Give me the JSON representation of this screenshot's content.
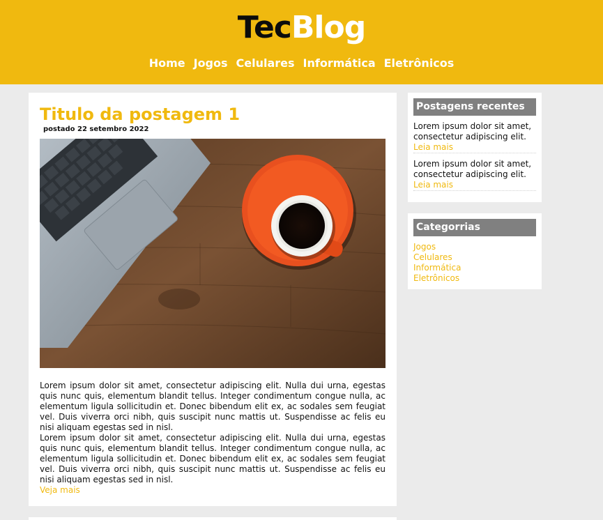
{
  "header": {
    "logo_part1": "Tec",
    "logo_part2": "Blog",
    "nav": [
      "Home",
      "Jogos",
      "Celulares",
      "Informática",
      "Eletrônicos"
    ]
  },
  "post": {
    "title": "Titulo da postagem 1",
    "date": "postado 22 setembro 2022",
    "image": "laptop and orange coffee cup on wooden desk",
    "paragraphs": [
      "Lorem ipsum dolor sit amet, consectetur adipiscing elit. Nulla dui urna, egestas quis nunc quis, elementum blandit tellus. Integer condimentum congue nulla, ac elementum ligula sollicitudin et. Donec bibendum elit ex, ac sodales sem feugiat vel. Duis viverra orci nibh, quis suscipit nunc mattis ut. Suspendisse ac felis eu nisi aliquam egestas sed in nisl.",
      "Lorem ipsum dolor sit amet, consectetur adipiscing elit. Nulla dui urna, egestas quis nunc quis, elementum blandit tellus. Integer condimentum congue nulla, ac elementum ligula sollicitudin et. Donec bibendum elit ex, ac sodales sem feugiat vel. Duis viverra orci nibh, quis suscipit nunc mattis ut. Suspendisse ac felis eu nisi aliquam egestas sed in nisl."
    ],
    "more": "Veja mais"
  },
  "sidebar": {
    "recent": {
      "title": "Postagens recentes",
      "items": [
        {
          "text": "Lorem ipsum dolor sit amet, consectetur adipiscing elit.",
          "more": "Leia mais"
        },
        {
          "text": "Lorem ipsum dolor sit amet, consectetur adipiscing elit.",
          "more": "Leia mais"
        }
      ]
    },
    "categories": {
      "title": "Categorrias",
      "items": [
        "Jogos",
        "Celulares",
        "Informática",
        "Eletrônicos"
      ]
    }
  },
  "colors": {
    "accent": "#f0b90f",
    "background": "#ebebeb",
    "widget_title": "#808080"
  }
}
